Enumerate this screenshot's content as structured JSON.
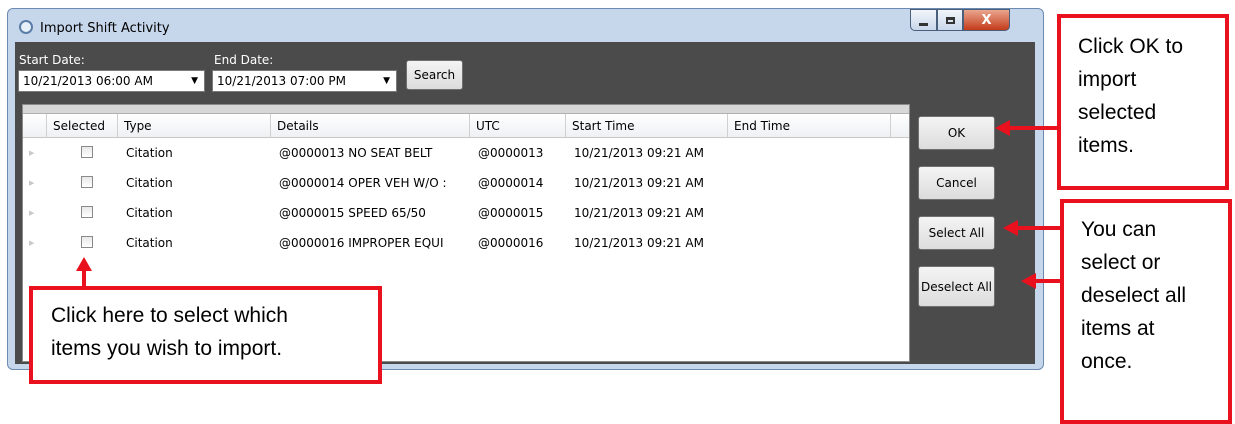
{
  "window": {
    "title": "Import Shift Activity",
    "close_glyph": "X"
  },
  "search": {
    "start_label": "Start Date:",
    "start_value": "10/21/2013 06:00 AM",
    "end_label": "End Date:",
    "end_value": "10/21/2013 07:00 PM",
    "button": "Search"
  },
  "table": {
    "columns": [
      "Selected",
      "Type",
      "Details",
      "UTC",
      "Start Time",
      "End Time"
    ],
    "rows": [
      {
        "selected": false,
        "type": "Citation",
        "details": "@0000013  NO SEAT BELT",
        "utc": "@0000013",
        "start": "10/21/2013 09:21 AM",
        "end": ""
      },
      {
        "selected": false,
        "type": "Citation",
        "details": "@0000014  OPER VEH W/O :",
        "utc": "@0000014",
        "start": "10/21/2013 09:21 AM",
        "end": ""
      },
      {
        "selected": false,
        "type": "Citation",
        "details": "@0000015 SPEED 65/50",
        "utc": "@0000015",
        "start": "10/21/2013 09:21 AM",
        "end": ""
      },
      {
        "selected": false,
        "type": "Citation",
        "details": "@0000016  IMPROPER EQUI",
        "utc": "@0000016",
        "start": "10/21/2013 09:21 AM",
        "end": ""
      }
    ]
  },
  "buttons": {
    "ok": "OK",
    "cancel": "Cancel",
    "select_all": "Select All",
    "deselect_all": "Deselect All"
  },
  "callouts": {
    "ok": [
      "Click OK to",
      "import",
      "selected",
      "items."
    ],
    "select": [
      "You can",
      "select or",
      "deselect all",
      "items at",
      "once."
    ],
    "checkbox": [
      "Click here to select which",
      "items you wish to import."
    ]
  },
  "colors": {
    "callout_red": "#e8111d",
    "panel_dark": "#4b4b4b",
    "window_frame": "#c6d7ec"
  }
}
